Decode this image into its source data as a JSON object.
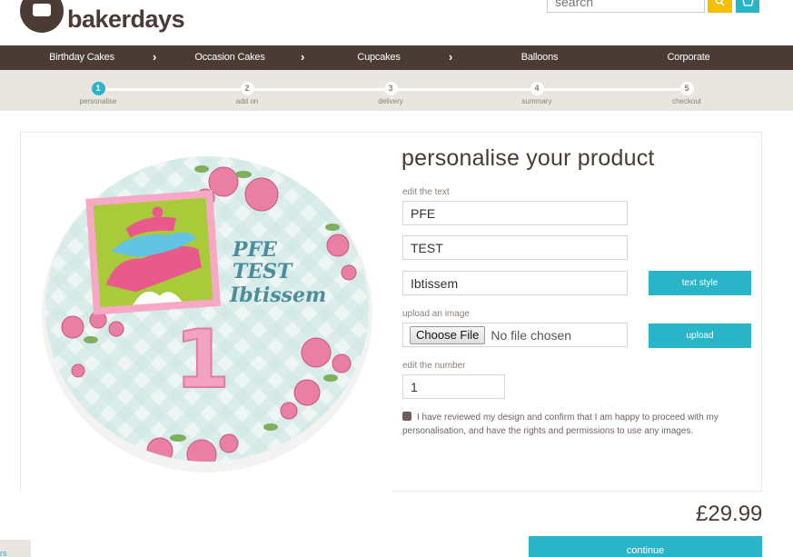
{
  "brand": {
    "name": "bakerdays"
  },
  "search": {
    "placeholder": "search"
  },
  "icons": {
    "search": "search-icon",
    "basket": "basket-icon",
    "arrow": "chevron-right-icon"
  },
  "colors": {
    "brown": "#4a3b35",
    "teal": "#29b4c8",
    "yellow": "#f5c000",
    "beige": "#e9e6e1"
  },
  "nav": {
    "items": [
      "Birthday Cakes",
      "Occasion Cakes",
      "Cupcakes",
      "Balloons",
      "Corporate"
    ]
  },
  "steps": [
    {
      "number": "1",
      "label": "personalise",
      "active": true
    },
    {
      "number": "2",
      "label": "add on",
      "active": false
    },
    {
      "number": "3",
      "label": "delivery",
      "active": false
    },
    {
      "number": "4",
      "label": "summary",
      "active": false
    },
    {
      "number": "5",
      "label": "checkout",
      "active": false
    }
  ],
  "cake": {
    "lines": [
      "PFE",
      "TEST",
      "Ibtissem"
    ],
    "number": "1"
  },
  "form": {
    "title": "personalise your product",
    "edit_text_label": "edit the text",
    "text_lines": [
      "PFE",
      "TEST",
      "Ibtissem"
    ],
    "text_style_button": "text style",
    "upload_label": "upload an image",
    "choose_file": "Choose File",
    "no_file": "No file chosen",
    "upload_button": "upload",
    "edit_number_label": "edit the number",
    "number_value": "1",
    "confirm_text": "I have reviewed my design and confirm that I am happy to proceed with my personalisation, and have the rights and permissions to use any images."
  },
  "price": "£29.99",
  "continue_button": "continue",
  "corner_tab": "rs"
}
